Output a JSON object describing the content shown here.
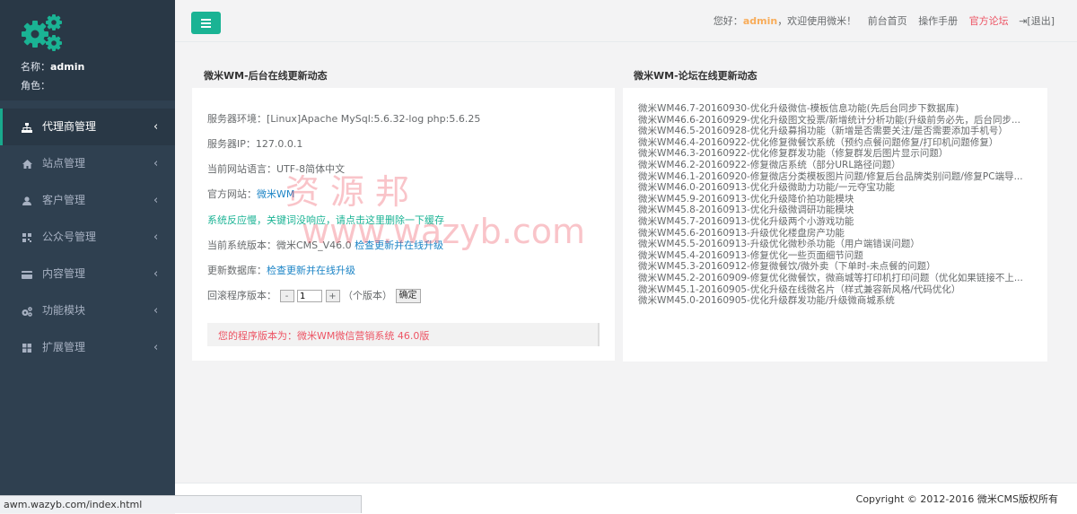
{
  "sidebar": {
    "name_label": "名称：",
    "name_value": "admin",
    "role_label": "角色：",
    "items": [
      {
        "label": "代理商管理",
        "icon": "sitemap-icon"
      },
      {
        "label": "站点管理",
        "icon": "home-icon"
      },
      {
        "label": "客户管理",
        "icon": "user-icon"
      },
      {
        "label": "公众号管理",
        "icon": "qrcode-icon"
      },
      {
        "label": "内容管理",
        "icon": "credit-card-icon"
      },
      {
        "label": "功能模块",
        "icon": "cogs-icon"
      },
      {
        "label": "扩展管理",
        "icon": "th-large-icon"
      }
    ]
  },
  "topbar": {
    "greeting_prefix": "您好：",
    "user": "admin",
    "greeting_suffix": "，欢迎使用微米！",
    "links": [
      "前台首页",
      "操作手册",
      "官方论坛",
      "[退出]"
    ]
  },
  "left_panel": {
    "title": "微米WM-后台在线更新动态",
    "server_env_label": "服务器环境：",
    "server_env_value": "[Linux]Apache MySql:5.6.32-log php:5.6.25",
    "server_ip_label": "服务器IP：",
    "server_ip_value": "127.0.0.1",
    "language_label": "当前网站语言：",
    "language_value": "UTF-8简体中文",
    "official_label": "官方网站：",
    "official_link": "微米WM",
    "warning": "系统反应慢，关键词没响应，请点击这里删除一下缓存",
    "version_label": "当前系统版本：",
    "version_value": "微米CMS_V46.0",
    "version_link": "检查更新并在线升级",
    "db_label": "更新数据库：",
    "db_link": "检查更新并在线升级",
    "rollback_label": "回滚程序版本：",
    "minus": "-",
    "rollback_value": "1",
    "plus": "+",
    "rollback_unit": "（个版本）",
    "confirm": "确定",
    "alert": "您的程序版本为：微米WM微信营销系统 46.0版"
  },
  "right_panel": {
    "title": "微米WM-论坛在线更新动态",
    "items": [
      "微米WM46.7-20160930-优化升级微信-模板信息功能(先后台同步下数据库)",
      "微米WM46.6-20160929-优化升级图文投票/新增统计分析功能(升级前务必先，后台同步...",
      "微米WM46.5-20160928-优化升级募捐功能（新增是否需要关注/是否需要添加手机号）",
      "微米WM46.4-20160922-优化修复微餐饮系统（预约点餐问题修复/打印机问题修复）",
      "微米WM46.3-20160922-优化修复群发功能（修复群发后图片显示问题）",
      "微米WM46.2-20160922-修复微店系统（部分URL路径问题）",
      "微米WM46.1-20160920-修复微店分类模板图片问题/修复后台品牌类别问题/修复PC端导...",
      "微米WM46.0-20160913-优化升级微助力功能/一元夺宝功能",
      "微米WM45.9-20160913-优化升级降价拍功能模块",
      "微米WM45.8-20160913-优化升级微调研功能模块",
      "微米WM45.7-20160913-优化升级两个小游戏功能",
      "微米WM45.6-20160913-升级优化楼盘房产功能",
      "微米WM45.5-20160913-升级优化微秒杀功能（用户端错误问题）",
      "微米WM45.4-20160913-修复优化一些页面细节问题",
      "微米WM45.3-20160912-修复微餐饮/微外卖（下单时-未点餐的问题）",
      "微米WM45.2-20160909-修复优化微餐饮，微商城等打印机打印问题（优化如果链接不上...",
      "微米WM45.1-20160905-优化升级在线微名片（样式兼容新风格/代码优化）",
      "微米WM45.0-20160905-优化升级群发功能/升级微商城系统"
    ]
  },
  "watermark": {
    "line1": "资源邦",
    "line2": "www.wazyb.com"
  },
  "footer": {
    "copyright": "Copyright © 2012-2016 微米CMS版权所有"
  },
  "statusbar": {
    "url": "awm.wazyb.com/index.html"
  },
  "colors": {
    "sidebar_bg": "#2f4050",
    "accent_green": "#1ab394",
    "link_blue": "#1c84c6",
    "alert_red": "#ed5565",
    "user_orange": "#f8ac59"
  }
}
